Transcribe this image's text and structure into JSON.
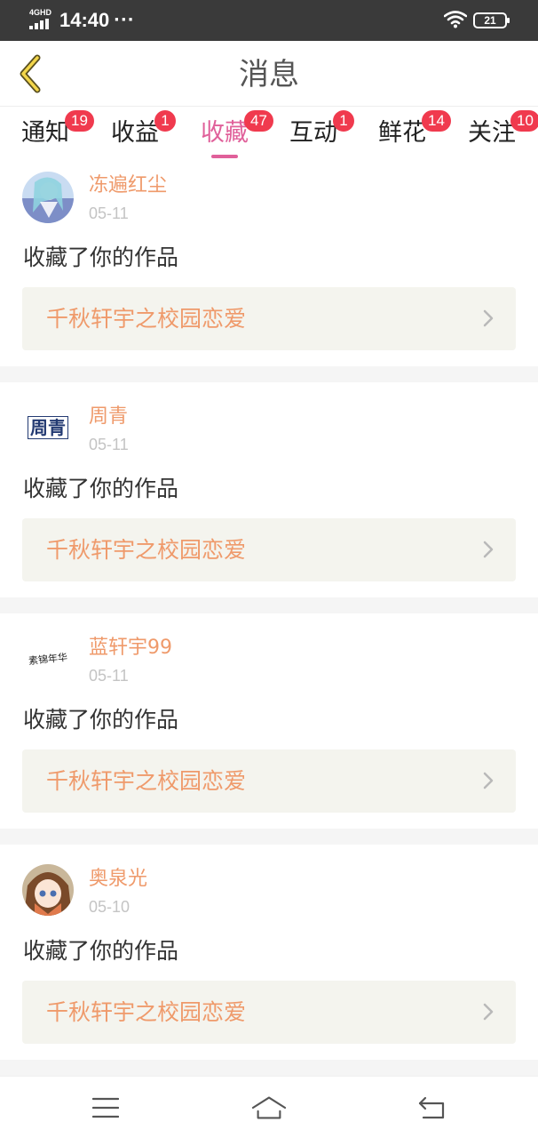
{
  "status_bar": {
    "network": "4GHD",
    "time": "14:40",
    "dots": "···",
    "battery": "21"
  },
  "header": {
    "title": "消息",
    "back_icon": "back-chevron-icon"
  },
  "tabs": [
    {
      "label": "通知",
      "badge": "19",
      "active": false
    },
    {
      "label": "收益",
      "badge": "1",
      "active": false
    },
    {
      "label": "收藏",
      "badge": "47",
      "active": true
    },
    {
      "label": "互动",
      "badge": "1",
      "active": false
    },
    {
      "label": "鲜花",
      "badge": "14",
      "active": false
    },
    {
      "label": "关注",
      "badge": "10",
      "active": false
    }
  ],
  "messages": [
    {
      "username": "冻遍红尘",
      "date": "05-11",
      "action": "收藏了你的作品",
      "work_title": "千秋轩宇之校园恋爱"
    },
    {
      "username": "周青",
      "date": "05-11",
      "action": "收藏了你的作品",
      "work_title": "千秋轩宇之校园恋爱",
      "avatar_text": "周青"
    },
    {
      "username": "蓝轩宇99",
      "date": "05-11",
      "action": "收藏了你的作品",
      "work_title": "千秋轩宇之校园恋爱",
      "avatar_text": "素锦年华"
    },
    {
      "username": "奥泉光",
      "date": "05-10",
      "action": "收藏了你的作品",
      "work_title": "千秋轩宇之校园恋爱"
    }
  ],
  "colors": {
    "accent_pink": "#e0609a",
    "username_orange": "#ef9a6b",
    "badge_red": "#f03a4e",
    "link_bg": "#f4f4ee"
  },
  "navbar": [
    "menu-icon",
    "home-icon",
    "return-icon"
  ]
}
